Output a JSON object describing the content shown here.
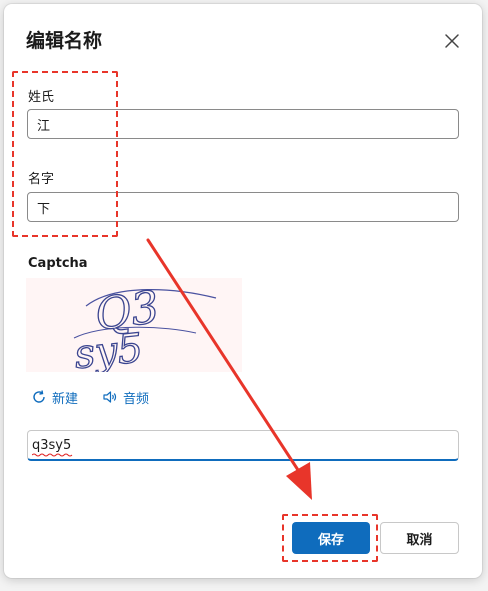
{
  "dialog": {
    "title": "编辑名称",
    "close_icon": "close-icon"
  },
  "form": {
    "last_name_label": "姓氏",
    "last_name_value": "江",
    "first_name_label": "名字",
    "first_name_value": "下",
    "captcha_label": "Captcha",
    "captcha_image_text": "Q3sy5",
    "new_label": "新建",
    "new_icon": "refresh-icon",
    "audio_label": "音频",
    "audio_icon": "speaker-icon",
    "captcha_value": "q3sy5"
  },
  "actions": {
    "save_label": "保存",
    "cancel_label": "取消"
  },
  "colors": {
    "accent": "#0f6cbd",
    "annotation_red": "#e8352a"
  }
}
